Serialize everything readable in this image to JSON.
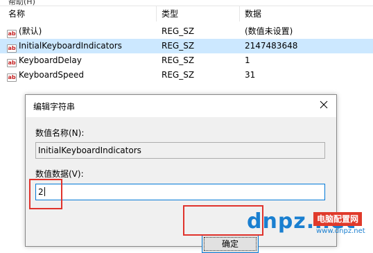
{
  "menu": {
    "partial_label": "帮助(H)"
  },
  "columns": {
    "name": "名称",
    "type": "类型",
    "data": "数据"
  },
  "rows": [
    {
      "name": "(默认)",
      "type": "REG_SZ",
      "data": "(数值未设置)",
      "selected": false
    },
    {
      "name": "InitialKeyboardIndicators",
      "type": "REG_SZ",
      "data": "2147483648",
      "selected": true
    },
    {
      "name": "KeyboardDelay",
      "type": "REG_SZ",
      "data": "1",
      "selected": false
    },
    {
      "name": "KeyboardSpeed",
      "type": "REG_SZ",
      "data": "31",
      "selected": false
    }
  ],
  "row_icon": {
    "text": "ab",
    "name": "string-value-icon"
  },
  "dialog": {
    "title": "编辑字符串",
    "value_name_label": "数值名称(N):",
    "value_name": "InitialKeyboardIndicators",
    "value_data_label": "数值数据(V):",
    "value_data": "2",
    "ok_label": "确定"
  },
  "colors": {
    "selection": "#cce8ff",
    "highlight": "#e0322b",
    "focus": "#0078d7"
  },
  "watermark": {
    "logo": "dnpz.net",
    "badge": "电脑配置网",
    "url": "www.dnpz.net"
  }
}
